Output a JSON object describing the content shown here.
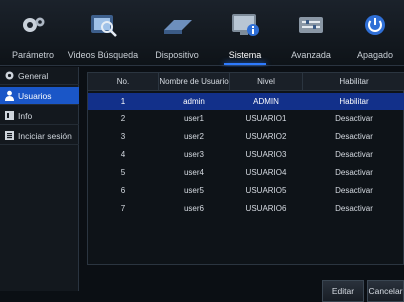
{
  "tabs": [
    {
      "label": "Parámetro",
      "icon": "gears-icon"
    },
    {
      "label": "Videos Búsqueda",
      "icon": "video-search-icon"
    },
    {
      "label": "Dispositivo",
      "icon": "hard-drive-icon"
    },
    {
      "label": "Sistema",
      "icon": "system-info-icon"
    },
    {
      "label": "Avanzada",
      "icon": "advanced-settings-icon"
    },
    {
      "label": "Apagado",
      "icon": "power-icon"
    }
  ],
  "sidebar": {
    "items": [
      {
        "label": "General",
        "icon": "gear-icon"
      },
      {
        "label": "Usuarios",
        "icon": "user-icon"
      },
      {
        "label": "Info",
        "icon": "info-icon"
      },
      {
        "label": "Inciciar sesión",
        "icon": "log-icon"
      }
    ]
  },
  "table": {
    "headers": [
      "No.",
      "Nombre de Usuario",
      "Nivel",
      "Habilitar"
    ],
    "rows": [
      [
        "1",
        "admin",
        "ADMIN",
        "Habilitar"
      ],
      [
        "2",
        "user1",
        "USUARIO1",
        "Desactivar"
      ],
      [
        "3",
        "user2",
        "USUARIO2",
        "Desactivar"
      ],
      [
        "4",
        "user3",
        "USUARIO3",
        "Desactivar"
      ],
      [
        "5",
        "user4",
        "USUARIO4",
        "Desactivar"
      ],
      [
        "6",
        "user5",
        "USUARIO5",
        "Desactivar"
      ],
      [
        "7",
        "user6",
        "USUARIO6",
        "Desactivar"
      ]
    ]
  },
  "buttons": {
    "edit": "Editar",
    "cancel": "Cancelar"
  },
  "colors": {
    "accent": "#1a56c7",
    "selected_row": "#12308a",
    "active_glow": "#2e7bff"
  }
}
